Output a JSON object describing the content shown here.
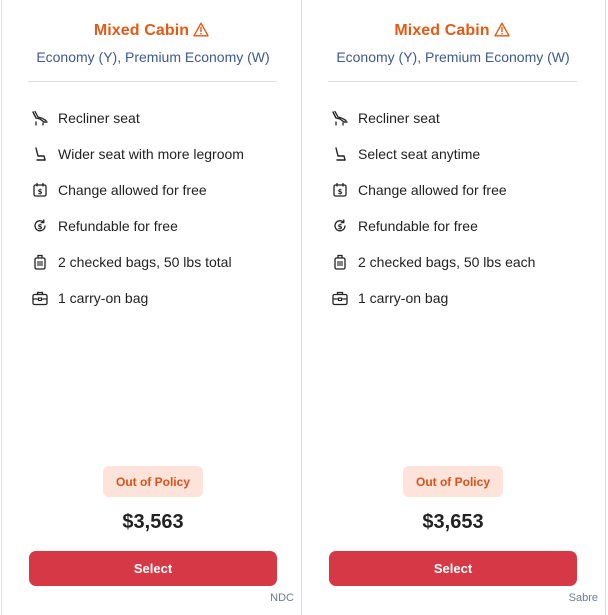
{
  "cards": [
    {
      "cabin_label": "Mixed Cabin",
      "cabin_icon": "warning-triangle-icon",
      "classes": "Economy (Y), Premium Economy (W)",
      "features": [
        {
          "icon": "recliner-seat-icon",
          "label": "Recliner seat"
        },
        {
          "icon": "seat-icon",
          "label": "Wider seat with more legroom"
        },
        {
          "icon": "change-calendar-icon",
          "label": "Change allowed for free"
        },
        {
          "icon": "refund-icon",
          "label": "Refundable for free"
        },
        {
          "icon": "checked-bag-icon",
          "label": "2 checked bags, 50 lbs total"
        },
        {
          "icon": "carry-on-bag-icon",
          "label": "1 carry-on bag"
        }
      ],
      "policy_badge": "Out of Policy",
      "price": "$3,563",
      "select_label": "Select",
      "source": "NDC"
    },
    {
      "cabin_label": "Mixed Cabin",
      "cabin_icon": "warning-triangle-icon",
      "classes": "Economy (Y), Premium Economy (W)",
      "features": [
        {
          "icon": "recliner-seat-icon",
          "label": "Recliner seat"
        },
        {
          "icon": "seat-icon",
          "label": "Select seat anytime"
        },
        {
          "icon": "change-calendar-icon",
          "label": "Change allowed for free"
        },
        {
          "icon": "refund-icon",
          "label": "Refundable for free"
        },
        {
          "icon": "checked-bag-icon",
          "label": "2 checked bags, 50 lbs each"
        },
        {
          "icon": "carry-on-bag-icon",
          "label": "1 carry-on bag"
        }
      ],
      "policy_badge": "Out of Policy",
      "price": "$3,653",
      "select_label": "Select",
      "source": "Sabre"
    }
  ],
  "colors": {
    "cabin_warning": "#e35a16",
    "classes_text": "#3e5a8e",
    "policy_bg": "#fde3d9",
    "policy_text": "#d8521a",
    "select_button": "#d63845"
  }
}
